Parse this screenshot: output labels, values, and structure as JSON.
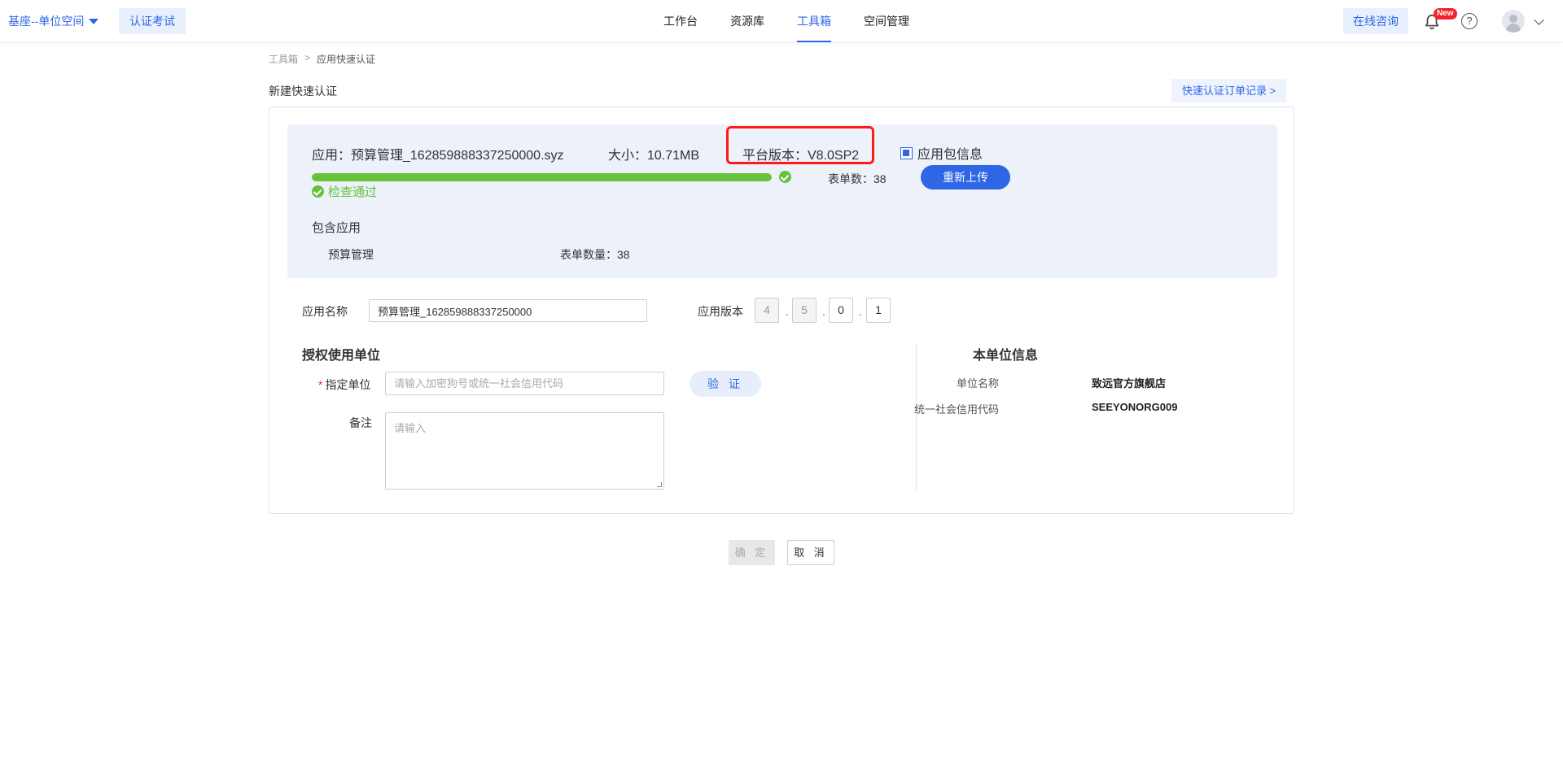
{
  "header": {
    "space_label": "基座--单位空间",
    "exam_label": "认证考试",
    "nav": [
      "工作台",
      "资源库",
      "工具箱",
      "空间管理"
    ],
    "consult_label": "在线咨询",
    "new_badge": "New",
    "help_glyph": "?"
  },
  "breadcrumb": {
    "root": "工具箱",
    "separator": ">",
    "current": "应用快速认证"
  },
  "page": {
    "title": "新建快速认证",
    "record_link": "快速认证订单记录 >"
  },
  "package": {
    "app": "应用：预算管理_162859888337250000.syz",
    "size": "大小：10.71MB",
    "platform_version": "平台版本：V8.0SP2",
    "info_checkbox": "应用包信息",
    "progress_percent": 100,
    "check_passed": "检查通过",
    "form_count": "表单数：38",
    "reupload": "重新上传",
    "contains_title": "包含应用",
    "contained_app_name": "预算管理",
    "contained_app_form_count": "表单数量：38"
  },
  "form": {
    "app_name_label": "应用名称",
    "app_name_value": "预算管理_162859888337250000",
    "app_version_label": "应用版本",
    "version": [
      "4",
      "5",
      "0",
      "1"
    ],
    "version_sep": ".",
    "auth_section": "授权使用单位",
    "unit_required": "*",
    "unit_label": "指定单位",
    "unit_placeholder": "请输入加密狗号或统一社会信用代码",
    "verify": "验 证",
    "remark_label": "备注",
    "remark_placeholder": "请输入"
  },
  "org_info": {
    "title": "本单位信息",
    "name_key": "单位名称",
    "name_value": "致远官方旗舰店",
    "code_key": "统一社会信用代码",
    "code_value": "SEEYONORG009"
  },
  "footer": {
    "ok": "确 定",
    "cancel": "取 消"
  },
  "colors": {
    "primary": "#2e66e6",
    "success": "#67c23a",
    "highlight": "#ff1a1a"
  }
}
